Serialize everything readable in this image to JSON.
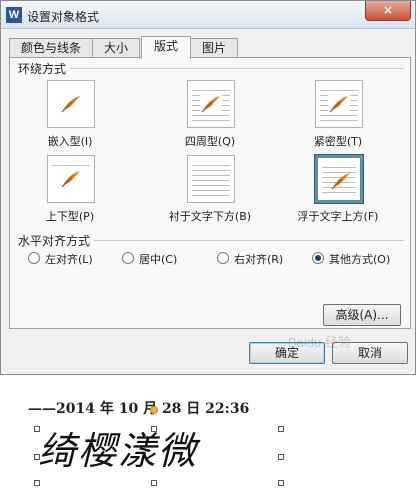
{
  "window": {
    "title": "设置对象格式",
    "app_icon_letter": "W",
    "close_symbol": "×"
  },
  "tabs": [
    {
      "label": "颜色与线条",
      "active": false
    },
    {
      "label": "大小",
      "active": false
    },
    {
      "label": "版式",
      "active": true
    },
    {
      "label": "图片",
      "active": false
    }
  ],
  "wrap_section": {
    "title": "环绕方式",
    "options": [
      {
        "label": "嵌入型(I)",
        "selected": false
      },
      {
        "label": "四周型(Q)",
        "selected": false
      },
      {
        "label": "紧密型(T)",
        "selected": false
      },
      {
        "label": "上下型(P)",
        "selected": false
      },
      {
        "label": "衬于文字下方(B)",
        "selected": false
      },
      {
        "label": "浮于文字上方(F)",
        "selected": true
      }
    ]
  },
  "align_section": {
    "title": "水平对齐方式",
    "options": [
      {
        "label": "左对齐(L)",
        "selected": false
      },
      {
        "label": "居中(C)",
        "selected": false
      },
      {
        "label": "右对齐(R)",
        "selected": false
      },
      {
        "label": "其他方式(O)",
        "selected": true
      }
    ]
  },
  "buttons": {
    "advanced": "高级(A)...",
    "ok": "确定",
    "cancel": "取消"
  },
  "document": {
    "date_line": "——2014 年 10 月 28 日  22:36",
    "signature": "绮樱漾微"
  },
  "watermark": "Baidu 经验",
  "colors": {
    "selected_border": "#5a8fa6",
    "quill": "#d9822b"
  }
}
